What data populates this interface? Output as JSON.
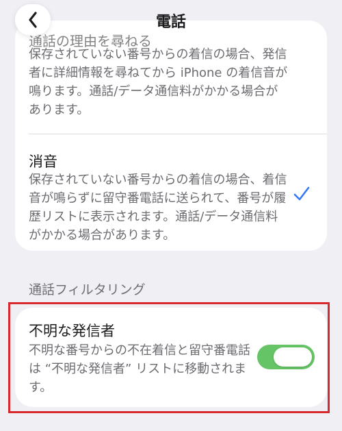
{
  "header": {
    "title": "電話",
    "back_icon": "chevron-left-icon"
  },
  "ask_reason": {
    "title_partial": "通話の理由を尋ねる",
    "description": "保存されていない番号からの着信の場合、発信者に詳細情報を尋ねてから iPhone の着信音が鳴ります。通話/データ通信料がかかる場合があります。"
  },
  "silence": {
    "title": "消音",
    "description": "保存されていない番号からの着信の場合、着信音が鳴らずに留守番電話に送られて、番号が履歴リストに表示されます。通話/データ通信料がかかる場合があります。",
    "selected": true,
    "check_icon": "checkmark-icon"
  },
  "call_filtering": {
    "section_header": "通話フィルタリング",
    "unknown_callers": {
      "title": "不明な発信者",
      "description": "不明な番号からの不在着信と留守番電話は “不明な発信者” リストに移動されます。",
      "toggle_on": true
    }
  },
  "colors": {
    "accent": "#3478f6",
    "toggle_on": "#65c466",
    "highlight": "#d6282d",
    "background": "#efeff4"
  }
}
